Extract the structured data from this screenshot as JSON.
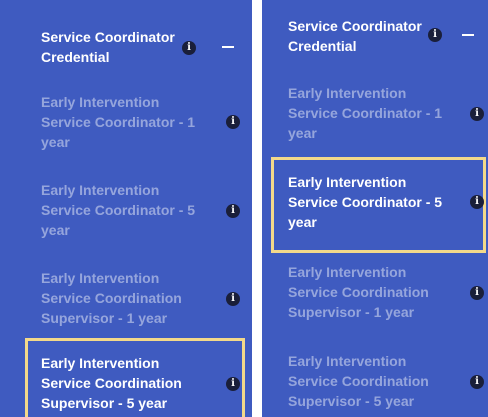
{
  "left": {
    "header": {
      "line1": "Service Coordinator",
      "line2": "Credential"
    },
    "items": [
      {
        "lines": [
          "Early Intervention",
          "Service Coordinator - 1",
          "year"
        ]
      },
      {
        "lines": [
          "Early Intervention",
          "Service Coordinator - 5",
          "year"
        ]
      },
      {
        "lines": [
          "Early Intervention",
          "Service Coordination",
          "Supervisor - 1 year"
        ]
      },
      {
        "lines": [
          "Early Intervention",
          "Service Coordination",
          "Supervisor - 5 year"
        ]
      }
    ]
  },
  "right": {
    "header": {
      "line1": "Service Coordinator",
      "line2": "Credential"
    },
    "items": [
      {
        "lines": [
          "Early Intervention",
          "Service Coordinator - 1",
          "year"
        ]
      },
      {
        "lines": [
          "Early Intervention",
          "Service Coordinator - 5",
          "year"
        ]
      },
      {
        "lines": [
          "Early Intervention",
          "Service Coordination",
          "Supervisor - 1 year"
        ]
      },
      {
        "lines": [
          "Early Intervention",
          "Service Coordination",
          "Supervisor - 5 year"
        ]
      }
    ]
  },
  "icons": {
    "info": "i",
    "collapse": "minus-icon"
  },
  "colors": {
    "panel_bg": "#3f5bc0",
    "highlight": "#f3d98a",
    "info_icon_bg": "#1a1f3a"
  }
}
